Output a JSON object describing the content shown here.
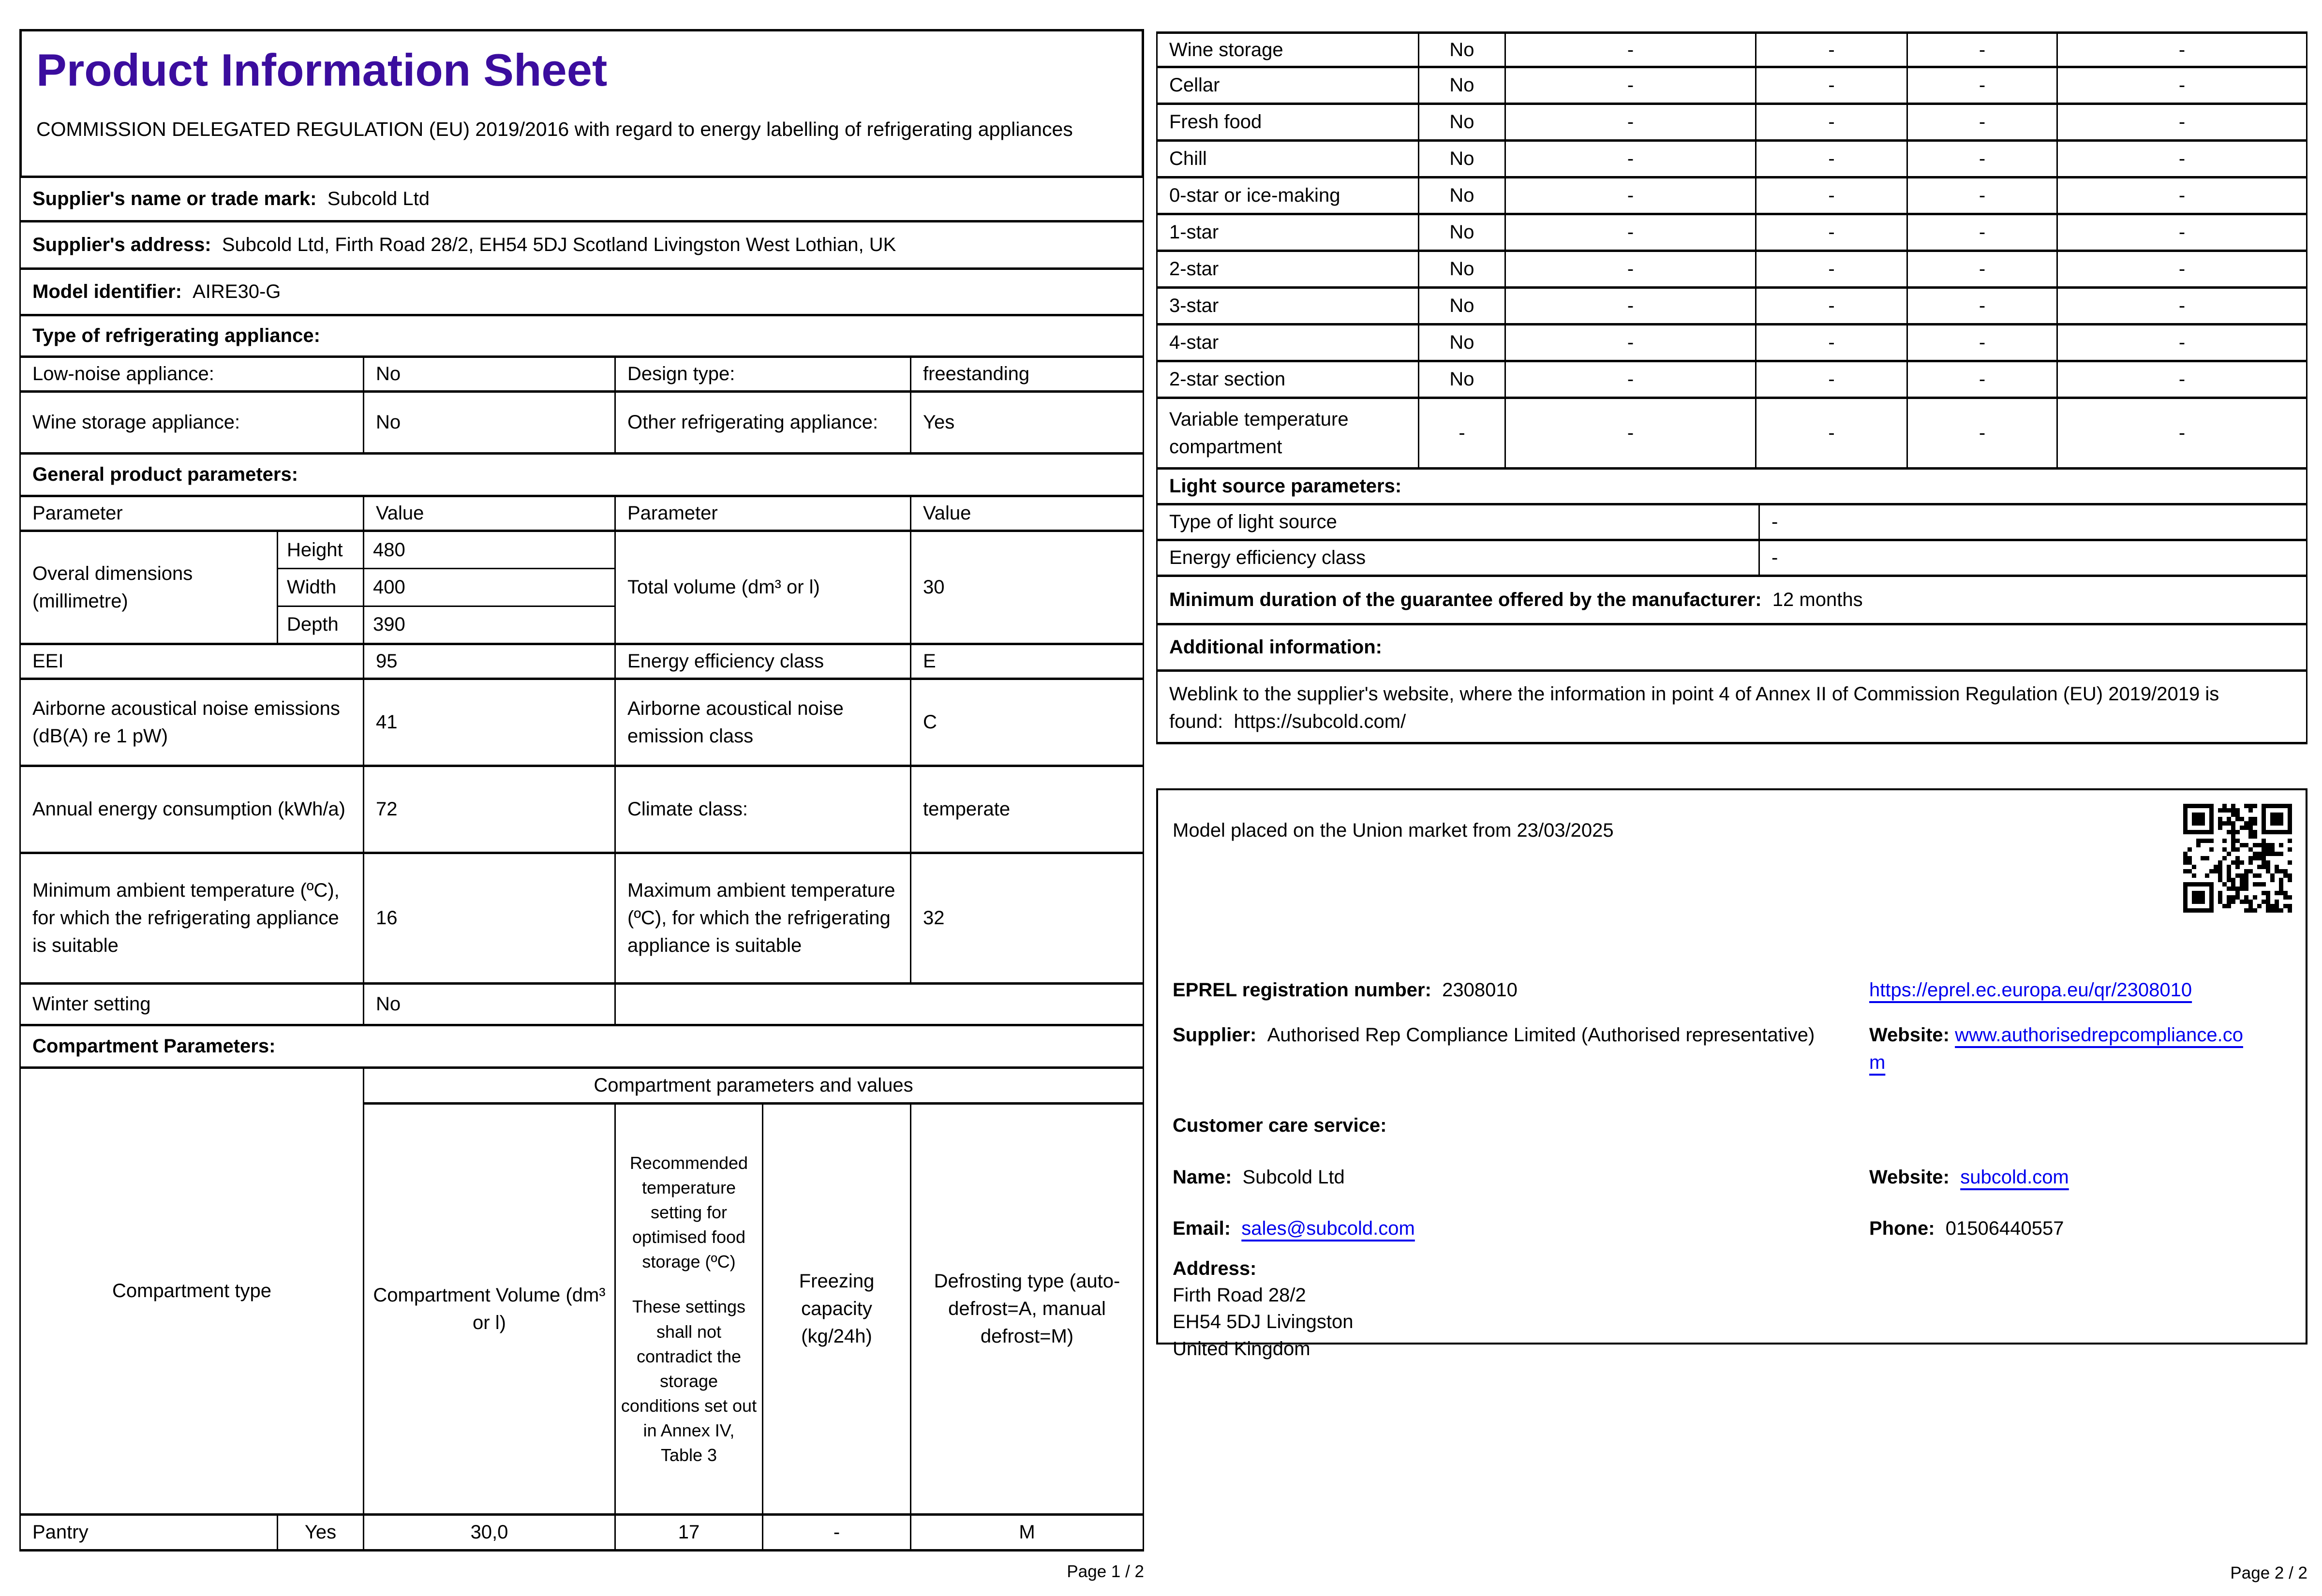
{
  "colors": {
    "title": "#3b0d9e",
    "link": "#0000ee",
    "border": "#000000"
  },
  "p1": {
    "title": "Product Information Sheet",
    "subtitle": "COMMISSION DELEGATED REGULATION (EU) 2019/2016 with regard to energy labelling of refrigerating appliances",
    "supplier_name_label": "Supplier's name or trade mark:",
    "supplier_name": "Subcold Ltd",
    "supplier_address_label": "Supplier's address:",
    "supplier_address": "Subcold Ltd, Firth Road 28/2, EH54 5DJ Scotland Livingston West Lothian, UK",
    "model_label": "Model identifier:",
    "model_value": "AIRE30-G",
    "type_section": "Type of refrigerating appliance:",
    "type_rows": [
      {
        "p1": "Low-noise appliance:",
        "v1": "No",
        "p2": "Design type:",
        "v2": "freestanding"
      },
      {
        "p1": "Wine storage appliance:",
        "v1": "No",
        "p2": "Other refrigerating appliance:",
        "v2": "Yes"
      }
    ],
    "general_section": "General product parameters:",
    "gp_header": {
      "param1": "Parameter",
      "value1": "Value",
      "param2": "Parameter",
      "value2": "Value"
    },
    "dims": {
      "label": "Overal dimensions (millimetre)",
      "rows": [
        {
          "k": "Height",
          "v": "480"
        },
        {
          "k": "Width",
          "v": "400"
        },
        {
          "k": "Depth",
          "v": "390"
        }
      ],
      "param": "Total volume (dm³ or l)",
      "value": "30"
    },
    "general_rows": [
      {
        "p1": "EEI",
        "v1": "95",
        "p2": "Energy efficiency class",
        "v2": "E"
      },
      {
        "p1": "Airborne acoustical noise emissions (dB(A) re 1 pW)",
        "v1": "41",
        "p2": "Airborne acoustical noise emission class",
        "v2": "C"
      },
      {
        "p1": "Annual energy consumption (kWh/a)",
        "v1": "72",
        "p2": "Climate class:",
        "v2": "temperate"
      },
      {
        "p1": "Minimum ambient temperature (ºC), for which the refrigerating appliance is suitable",
        "v1": "16",
        "p2": "Maximum ambient temperature (ºC), for which the refrigerating appliance is suitable",
        "v2": "32"
      }
    ],
    "winter": {
      "label": "Winter setting",
      "value": "No"
    },
    "comp_section": "Compartment Parameters:",
    "comp_header": "Compartment parameters and values",
    "comp_cols": {
      "type": "Compartment type",
      "volume": "Compartment Volume (dm³ or l)",
      "temp1": "Recommended temperature setting for optimised food storage (ºC)",
      "temp2": "These settings shall not contradict the storage conditions set out in Annex IV, Table 3",
      "freezing": "Freezing capacity (kg/24h)",
      "defrost": "Defrosting type (auto-defrost=A, manual defrost=M)"
    },
    "pantry": {
      "type": "Pantry",
      "present": "Yes",
      "volume": "30,0",
      "temp": "17",
      "freezing": "-",
      "defrost": "M"
    },
    "page_label": "Page 1 / 2"
  },
  "p2": {
    "rows": [
      {
        "label": "Wine storage",
        "present": "No",
        "d1": "-",
        "d2": "-",
        "d3": "-",
        "d4": "-"
      },
      {
        "label": "Cellar",
        "present": "No",
        "d1": "-",
        "d2": "-",
        "d3": "-",
        "d4": "-"
      },
      {
        "label": "Fresh food",
        "present": "No",
        "d1": "-",
        "d2": "-",
        "d3": "-",
        "d4": "-"
      },
      {
        "label": "Chill",
        "present": "No",
        "d1": "-",
        "d2": "-",
        "d3": "-",
        "d4": "-"
      },
      {
        "label": "0-star or ice-making",
        "present": "No",
        "d1": "-",
        "d2": "-",
        "d3": "-",
        "d4": "-"
      },
      {
        "label": "1-star",
        "present": "No",
        "d1": "-",
        "d2": "-",
        "d3": "-",
        "d4": "-"
      },
      {
        "label": "2-star",
        "present": "No",
        "d1": "-",
        "d2": "-",
        "d3": "-",
        "d4": "-"
      },
      {
        "label": "3-star",
        "present": "No",
        "d1": "-",
        "d2": "-",
        "d3": "-",
        "d4": "-"
      },
      {
        "label": "4-star",
        "present": "No",
        "d1": "-",
        "d2": "-",
        "d3": "-",
        "d4": "-"
      },
      {
        "label": "2-star section",
        "present": "No",
        "d1": "-",
        "d2": "-",
        "d3": "-",
        "d4": "-"
      },
      {
        "label": "Variable temperature compartment",
        "present": "-",
        "d1": "-",
        "d2": "-",
        "d3": "-",
        "d4": "-"
      }
    ],
    "light_section": "Light source parameters:",
    "light_rows": [
      {
        "label": "Type of light source",
        "value": "-"
      },
      {
        "label": "Energy efficiency class",
        "value": "-"
      }
    ],
    "guarantee_label": "Minimum duration of the guarantee offered by the manufacturer:",
    "guarantee_value": "12 months",
    "additional_section": "Additional information:",
    "weblink_text": "Weblink to the supplier's website, where the information in point 4 of Annex II of Commission Regulation (EU) 2019/2019 is found:",
    "weblink_url": "https://subcold.com/",
    "box": {
      "market_text": "Model placed on the Union market from 23/03/2025",
      "eprel_label": "EPREL registration number:",
      "eprel_value": "2308010",
      "eprel_link": "https://eprel.ec.europa.eu/qr/2308010",
      "supplier_label": "Supplier:",
      "supplier_value": "Authorised Rep Compliance Limited (Authorised representative)",
      "website_label": "Website:",
      "website_value": "www.authorisedrepcompliance.com",
      "care_section": "Customer care service:",
      "name_label": "Name:",
      "name_value": "Subcold Ltd",
      "care_website_label": "Website:",
      "care_website_value": "subcold.com",
      "email_label": "Email:",
      "email_value": "sales@subcold.com",
      "phone_label": "Phone:",
      "phone_value": "01506440557",
      "address_label": "Address:",
      "address_line1": "Firth Road 28/2",
      "address_line2": " EH54 5DJ Livingston",
      "address_line3": "United Kingdom"
    },
    "page_label": "Page 2 / 2"
  }
}
